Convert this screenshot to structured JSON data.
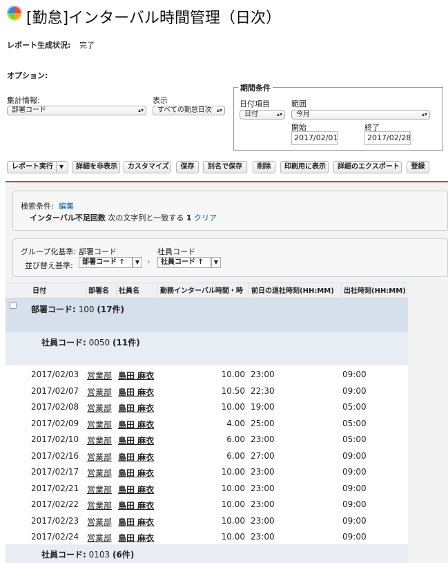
{
  "title": "[勤怠]インターバル時間管理（日次）",
  "status": {
    "label": "レポート生成状況:",
    "value": "完了"
  },
  "options_label": "オプション:",
  "summary": {
    "label": "集計情報:",
    "value": "部署コード"
  },
  "display": {
    "label": "表示",
    "value": "すべての勤怠日次"
  },
  "period": {
    "legend": "期間条件",
    "date_field_label": "日付項目",
    "date_field_value": "日付",
    "range_label": "範囲",
    "range_value": "今月",
    "start_label": "開始",
    "start_value": "2017/02/01",
    "end_label": "終了",
    "end_value": "2017/02/28"
  },
  "toolbar": {
    "run": "レポート実行",
    "hide_details": "詳細を非表示",
    "customize": "カスタマイズ",
    "save": "保存",
    "save_as": "別名で保存",
    "delete": "削除",
    "printable": "印刷用に表示",
    "export": "詳細のエクスポート",
    "schedule": "登録"
  },
  "filters": {
    "label": "検索条件:",
    "edit": "編集",
    "field": "インターバル不足回数",
    "op": "次の文字列と一致する",
    "value": "1",
    "clear": "クリア"
  },
  "grouping": {
    "group_label": "グループ化基準:",
    "sort_label": "並び替え基準:",
    "g1_name": "部署コード",
    "g1_sort": "部署コード ↑",
    "g2_name": "社員コード",
    "g2_sort": "社員コード ↑"
  },
  "columns": [
    "日付",
    "部署名",
    "社員名",
    "勤務インターバル時間・時",
    "前日の退社時刻(HH:MM)",
    "出社時刻(HH:MM)"
  ],
  "group1": {
    "label": "部署コード:",
    "value": "100",
    "count": "(17件)"
  },
  "group2": {
    "label": "社員コード:",
    "value": "0050",
    "count": "(11件)"
  },
  "group3": {
    "label": "社員コード:",
    "value": "0103",
    "count": "(6件)"
  },
  "rows": [
    {
      "date": "2017/02/03",
      "dept": "営業部",
      "emp": "島田 麻衣",
      "interval": "10.00",
      "prev": "23:00",
      "in": "09:00"
    },
    {
      "date": "2017/02/07",
      "dept": "営業部",
      "emp": "島田 麻衣",
      "interval": "10.50",
      "prev": "22:30",
      "in": "09:00"
    },
    {
      "date": "2017/02/08",
      "dept": "営業部",
      "emp": "島田 麻衣",
      "interval": "10.00",
      "prev": "19:00",
      "in": "05:00"
    },
    {
      "date": "2017/02/09",
      "dept": "営業部",
      "emp": "島田 麻衣",
      "interval": "4.00",
      "prev": "25:00",
      "in": "05:00"
    },
    {
      "date": "2017/02/10",
      "dept": "営業部",
      "emp": "島田 麻衣",
      "interval": "6.00",
      "prev": "23:00",
      "in": "05:00"
    },
    {
      "date": "2017/02/16",
      "dept": "営業部",
      "emp": "島田 麻衣",
      "interval": "6.00",
      "prev": "27:00",
      "in": "09:00"
    },
    {
      "date": "2017/02/17",
      "dept": "営業部",
      "emp": "島田 麻衣",
      "interval": "10.00",
      "prev": "23:00",
      "in": "09:00"
    },
    {
      "date": "2017/02/21",
      "dept": "営業部",
      "emp": "島田 麻衣",
      "interval": "10.00",
      "prev": "23:00",
      "in": "09:00"
    },
    {
      "date": "2017/02/22",
      "dept": "営業部",
      "emp": "島田 麻衣",
      "interval": "10.00",
      "prev": "23:00",
      "in": "09:00"
    },
    {
      "date": "2017/02/23",
      "dept": "営業部",
      "emp": "島田 麻衣",
      "interval": "10.00",
      "prev": "23:00",
      "in": "09:00"
    },
    {
      "date": "2017/02/24",
      "dept": "営業部",
      "emp": "島田 麻衣",
      "interval": "10.00",
      "prev": "23:00",
      "in": "09:00"
    }
  ]
}
